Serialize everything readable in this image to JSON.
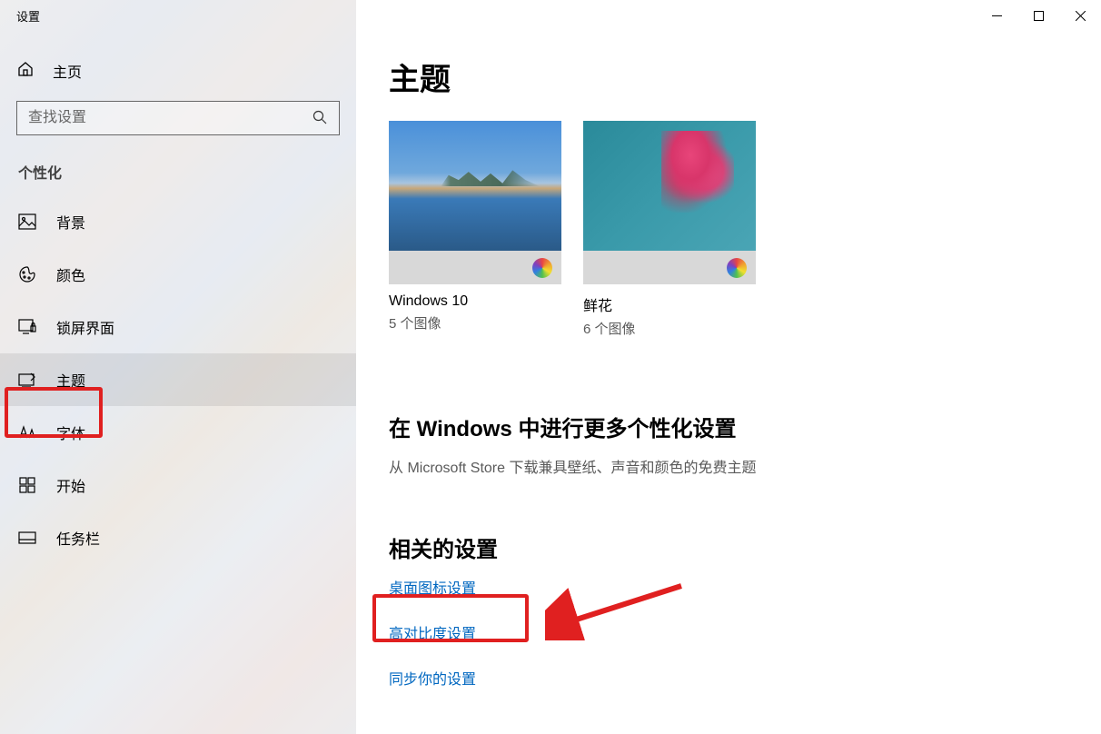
{
  "window": {
    "title": "设置"
  },
  "sidebar": {
    "home": "主页",
    "search_placeholder": "查找设置",
    "section": "个性化",
    "items": [
      {
        "label": "背景",
        "active": false
      },
      {
        "label": "颜色",
        "active": false
      },
      {
        "label": "锁屏界面",
        "active": false
      },
      {
        "label": "主题",
        "active": true
      },
      {
        "label": "字体",
        "active": false
      },
      {
        "label": "开始",
        "active": false
      },
      {
        "label": "任务栏",
        "active": false
      }
    ]
  },
  "content": {
    "heading": "主题",
    "themes": [
      {
        "name": "Windows 10",
        "count": "5 个图像"
      },
      {
        "name": "鲜花",
        "count": "6 个图像"
      }
    ],
    "more_heading": "在 Windows 中进行更多个性化设置",
    "more_subtext": "从 Microsoft Store 下载兼具壁纸、声音和颜色的免费主题",
    "related_heading": "相关的设置",
    "links": [
      {
        "label": "桌面图标设置"
      },
      {
        "label": "高对比度设置"
      },
      {
        "label": "同步你的设置"
      }
    ]
  }
}
